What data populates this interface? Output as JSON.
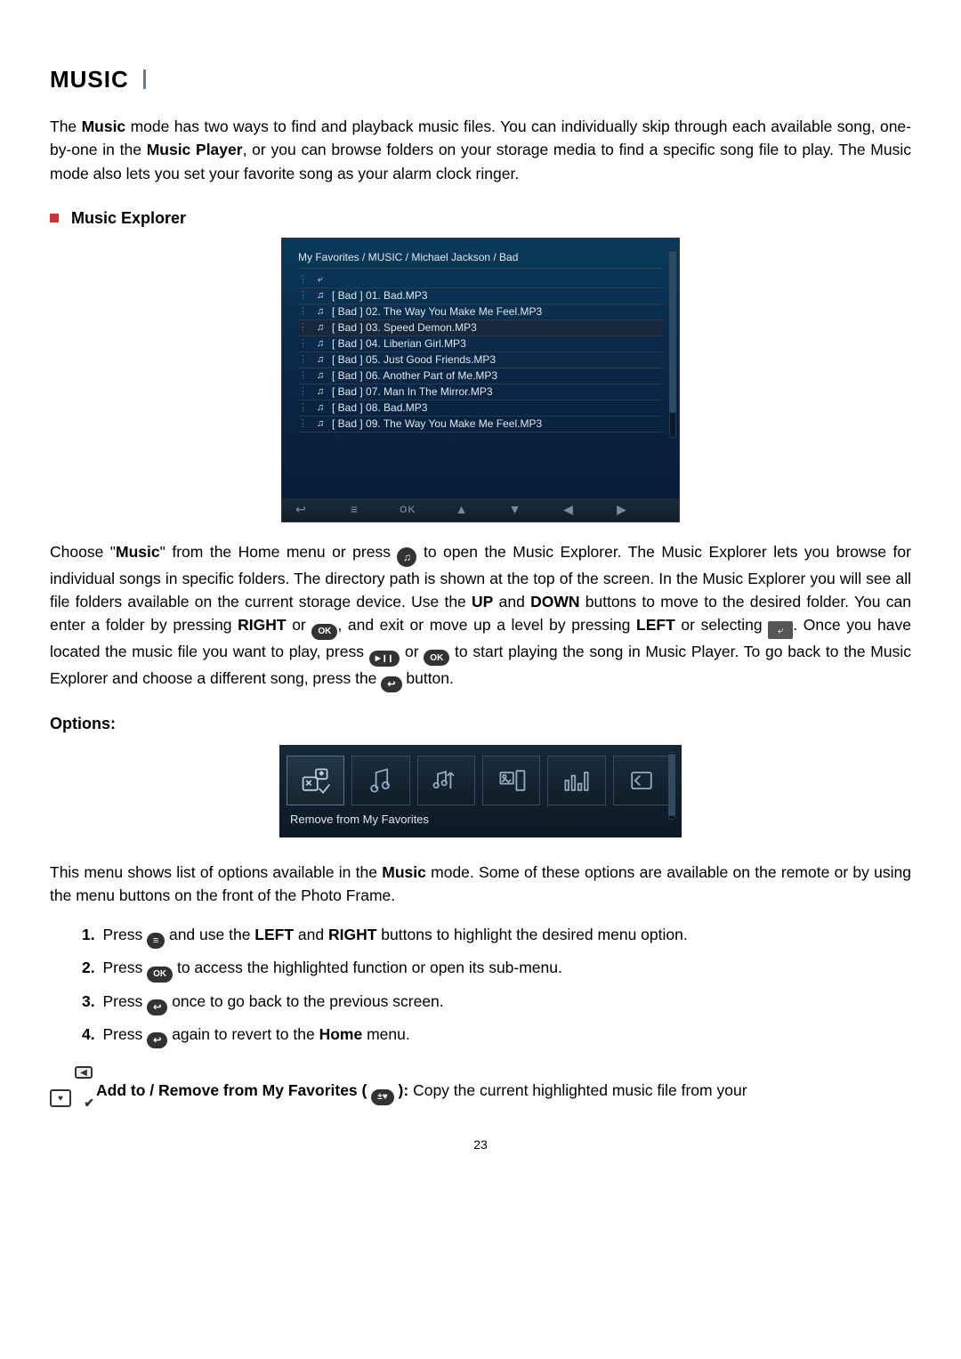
{
  "title": "MUSIC",
  "intro_parts": {
    "p1a": "The ",
    "p1b": "Music",
    "p1c": " mode has two ways to find and playback music files. You can individually skip through each available song, one-by-one in the ",
    "p1d": "Music Player",
    "p1e": ", or you can browse folders on your storage media to find a specific song file to play. The Music mode also lets you set your favorite song as your alarm clock ringer."
  },
  "section_header": "Music Explorer",
  "explorer": {
    "breadcrumb": "My Favorites / MUSIC / Michael Jackson / Bad",
    "files": [
      "[ Bad ] 01. Bad.MP3",
      "[ Bad ] 02. The Way You Make Me Feel.MP3",
      "[ Bad ] 03. Speed Demon.MP3",
      "[ Bad ] 04. Liberian Girl.MP3",
      "[ Bad ] 05. Just Good Friends.MP3",
      "[ Bad ] 06. Another Part of Me.MP3",
      "[ Bad ] 07. Man In The Mirror.MP3",
      "[ Bad ] 08. Bad.MP3",
      "[ Bad ] 09. The Way You Make Me Feel.MP3"
    ],
    "selected_index": 2,
    "bottom_ok": "OK"
  },
  "body": {
    "t01": "Choose \"",
    "t02": "Music",
    "t03": "\" from the Home menu or press ",
    "t04": " to open the Music Explorer. The Music Explorer lets you browse for individual songs in specific folders. The directory path is shown at the top of the screen. In the Music Explorer you will see all file folders available on the current storage device. Use the ",
    "t05": "UP",
    "t06": " and ",
    "t07": "DOWN",
    "t08": " buttons to move to the desired folder. You can enter a folder by pressing ",
    "t09": "RIGHT",
    "t10": " or ",
    "t11": ", and exit or move up a level by pressing ",
    "t12": "LEFT",
    "t13": " or selecting ",
    "t14": ". Once you have located the music file you want to play, press ",
    "t15": " or ",
    "t16": " to start playing the song in Music Player. To go back to the Music Explorer and choose a different song, press the ",
    "t17": " button."
  },
  "ok_label": "OK",
  "options_heading": "Options:",
  "options_label": "Remove from My Favorites",
  "options_intro": {
    "a": "This menu shows list of options available in the ",
    "b": "Music",
    "c": " mode. Some of these options are available on the remote or by using the menu buttons on the front of the Photo Frame."
  },
  "steps": {
    "s1": {
      "num": "1.",
      "a": "Press ",
      "b": " and use the ",
      "c": "LEFT",
      "d": " and ",
      "e": "RIGHT",
      "f": " buttons to highlight the desired menu option."
    },
    "s2": {
      "num": "2.",
      "a": "Press ",
      "b": " to access the highlighted function or open its sub-menu."
    },
    "s3": {
      "num": "3.",
      "a": "Press ",
      "b": " once to go back to the previous screen."
    },
    "s4": {
      "num": "4.",
      "a": "Press ",
      "b": " again to revert to the ",
      "c": "Home",
      "d": " menu."
    }
  },
  "favorites": {
    "a": "Add to / Remove from My Favorites (",
    "b": "):",
    "c": " Copy the current highlighted music file from your"
  },
  "page_number": "23"
}
